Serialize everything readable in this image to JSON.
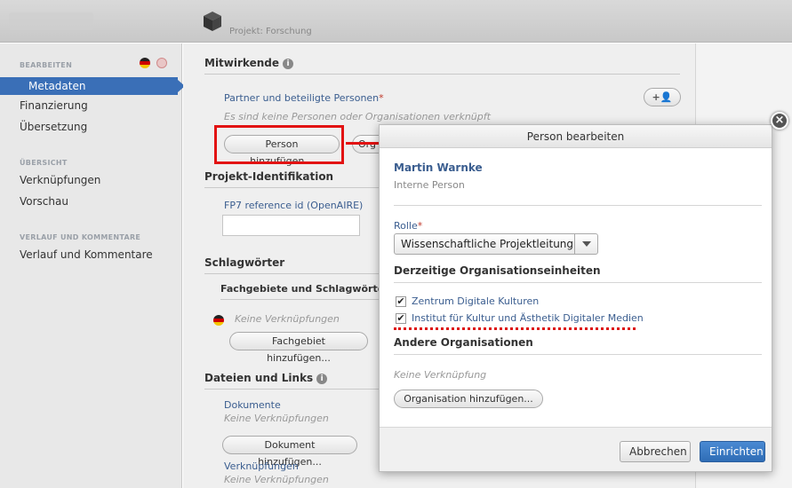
{
  "header": {
    "project_label": "Projekt: Forschung"
  },
  "sidebar": {
    "sections": [
      {
        "title": "BEARBEITEN",
        "items": [
          "Metadaten",
          "Finanzierung",
          "Übersetzung"
        ]
      },
      {
        "title": "ÜBERSICHT",
        "items": [
          "Verknüpfungen",
          "Vorschau"
        ]
      },
      {
        "title": "VERLAUF UND KOMMENTARE",
        "items": [
          "Verlauf und Kommentare"
        ]
      }
    ]
  },
  "main": {
    "mitwirkende": {
      "title": "Mitwirkende",
      "partner_label": "Partner und beteiligte Personen",
      "empty": "Es sind keine Personen oder Organisationen verknüpft",
      "add_person": "Person hinzufügen...",
      "add_org_partial": "Org"
    },
    "identifikation": {
      "title": "Projekt-Identifikation",
      "field_label": "FP7 reference id (OpenAIRE)"
    },
    "schlagwoerter": {
      "title": "Schlagwörter",
      "sub": "Fachgebiete und Schlagwörter",
      "empty": "Keine Verknüpfungen",
      "add": "Fachgebiet hinzufügen..."
    },
    "dateien": {
      "title": "Dateien und Links",
      "docs_label": "Dokumente",
      "docs_empty": "Keine Verknüpfungen",
      "add_doc": "Dokument hinzufügen...",
      "links_label": "Verknüpfungen",
      "links_empty": "Keine Verknüpfungen"
    }
  },
  "modal": {
    "title": "Person bearbeiten",
    "person_name": "Martin Warnke",
    "person_type": "Interne Person",
    "role_label": "Rolle",
    "role_value": "Wissenschaftliche Projektleitung",
    "current_orgs_title": "Derzeitige Organisationseinheiten",
    "orgs": [
      "Zentrum Digitale Kulturen",
      "Institut für Kultur und Ästhetik Digitaler Medien"
    ],
    "other_orgs_title": "Andere Organisationen",
    "other_empty": "Keine Verknüpfung",
    "add_org": "Organisation hinzufügen...",
    "cancel": "Abbrechen",
    "submit": "Einrichten"
  },
  "icons": {
    "close": "×",
    "star": "*",
    "info": "i",
    "check": "✔",
    "add_person_icon": "+👤"
  },
  "colors": {
    "accent": "#3a6fb7",
    "highlight": "#e21313"
  }
}
